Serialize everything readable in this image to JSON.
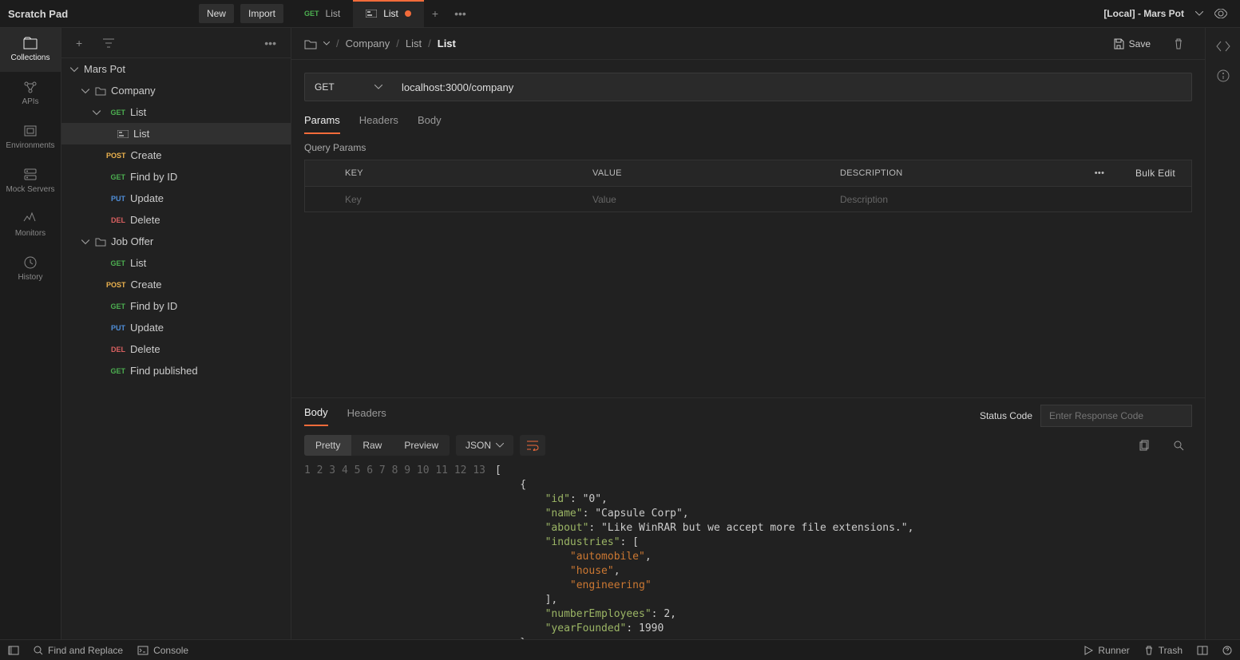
{
  "header": {
    "title": "Scratch Pad",
    "new_btn": "New",
    "import_btn": "Import",
    "tabs": [
      {
        "method": "GET",
        "label": "List",
        "kind": "request",
        "dirty": false,
        "active": false
      },
      {
        "method": "",
        "label": "List",
        "kind": "example",
        "dirty": true,
        "active": true
      }
    ],
    "environment": "[Local] - Mars Pot"
  },
  "rail": {
    "items": [
      {
        "label": "Collections",
        "icon": "collections",
        "active": true
      },
      {
        "label": "APIs",
        "icon": "apis"
      },
      {
        "label": "Environments",
        "icon": "environments"
      },
      {
        "label": "Mock Servers",
        "icon": "mockservers"
      },
      {
        "label": "Monitors",
        "icon": "monitors"
      },
      {
        "label": "History",
        "icon": "history"
      }
    ]
  },
  "collections": {
    "root": "Mars Pot",
    "folders": [
      {
        "name": "Company",
        "items": [
          {
            "method": "GET",
            "name": "List",
            "open": true,
            "children": [
              {
                "type": "example",
                "name": "List",
                "selected": true
              }
            ]
          },
          {
            "method": "POST",
            "name": "Create"
          },
          {
            "method": "GET",
            "name": "Find by ID"
          },
          {
            "method": "PUT",
            "name": "Update"
          },
          {
            "method": "DEL",
            "name": "Delete"
          }
        ]
      },
      {
        "name": "Job Offer",
        "items": [
          {
            "method": "GET",
            "name": "List"
          },
          {
            "method": "POST",
            "name": "Create"
          },
          {
            "method": "GET",
            "name": "Find by ID"
          },
          {
            "method": "PUT",
            "name": "Update"
          },
          {
            "method": "DEL",
            "name": "Delete"
          },
          {
            "method": "GET",
            "name": "Find published"
          }
        ]
      }
    ]
  },
  "breadcrumb": {
    "parts": [
      "Company",
      "List"
    ],
    "current": "List"
  },
  "save_label": "Save",
  "request": {
    "method": "GET",
    "url": "localhost:3000/company",
    "tabs": [
      "Params",
      "Headers",
      "Body"
    ],
    "active_tab": "Params",
    "query_params_label": "Query Params",
    "columns": {
      "key": "KEY",
      "value": "VALUE",
      "description": "DESCRIPTION"
    },
    "placeholders": {
      "key": "Key",
      "value": "Value",
      "description": "Description"
    },
    "bulk_edit": "Bulk Edit"
  },
  "response": {
    "tabs": [
      "Body",
      "Headers"
    ],
    "active_tab": "Body",
    "status_label": "Status Code",
    "status_placeholder": "Enter Response Code",
    "modes": [
      "Pretty",
      "Raw",
      "Preview"
    ],
    "active_mode": "Pretty",
    "format": "JSON",
    "body_lines": [
      "[",
      "    {",
      "        \"id\": \"0\",",
      "        \"name\": \"Capsule Corp\",",
      "        \"about\": \"Like WinRAR but we accept more file extensions.\",",
      "        \"industries\": [",
      "            \"automobile\",",
      "            \"house\",",
      "            \"engineering\"",
      "        ],",
      "        \"numberEmployees\": 2,",
      "        \"yearFounded\": 1990",
      "    },"
    ]
  },
  "statusbar": {
    "find": "Find and Replace",
    "console": "Console",
    "runner": "Runner",
    "trash": "Trash"
  }
}
